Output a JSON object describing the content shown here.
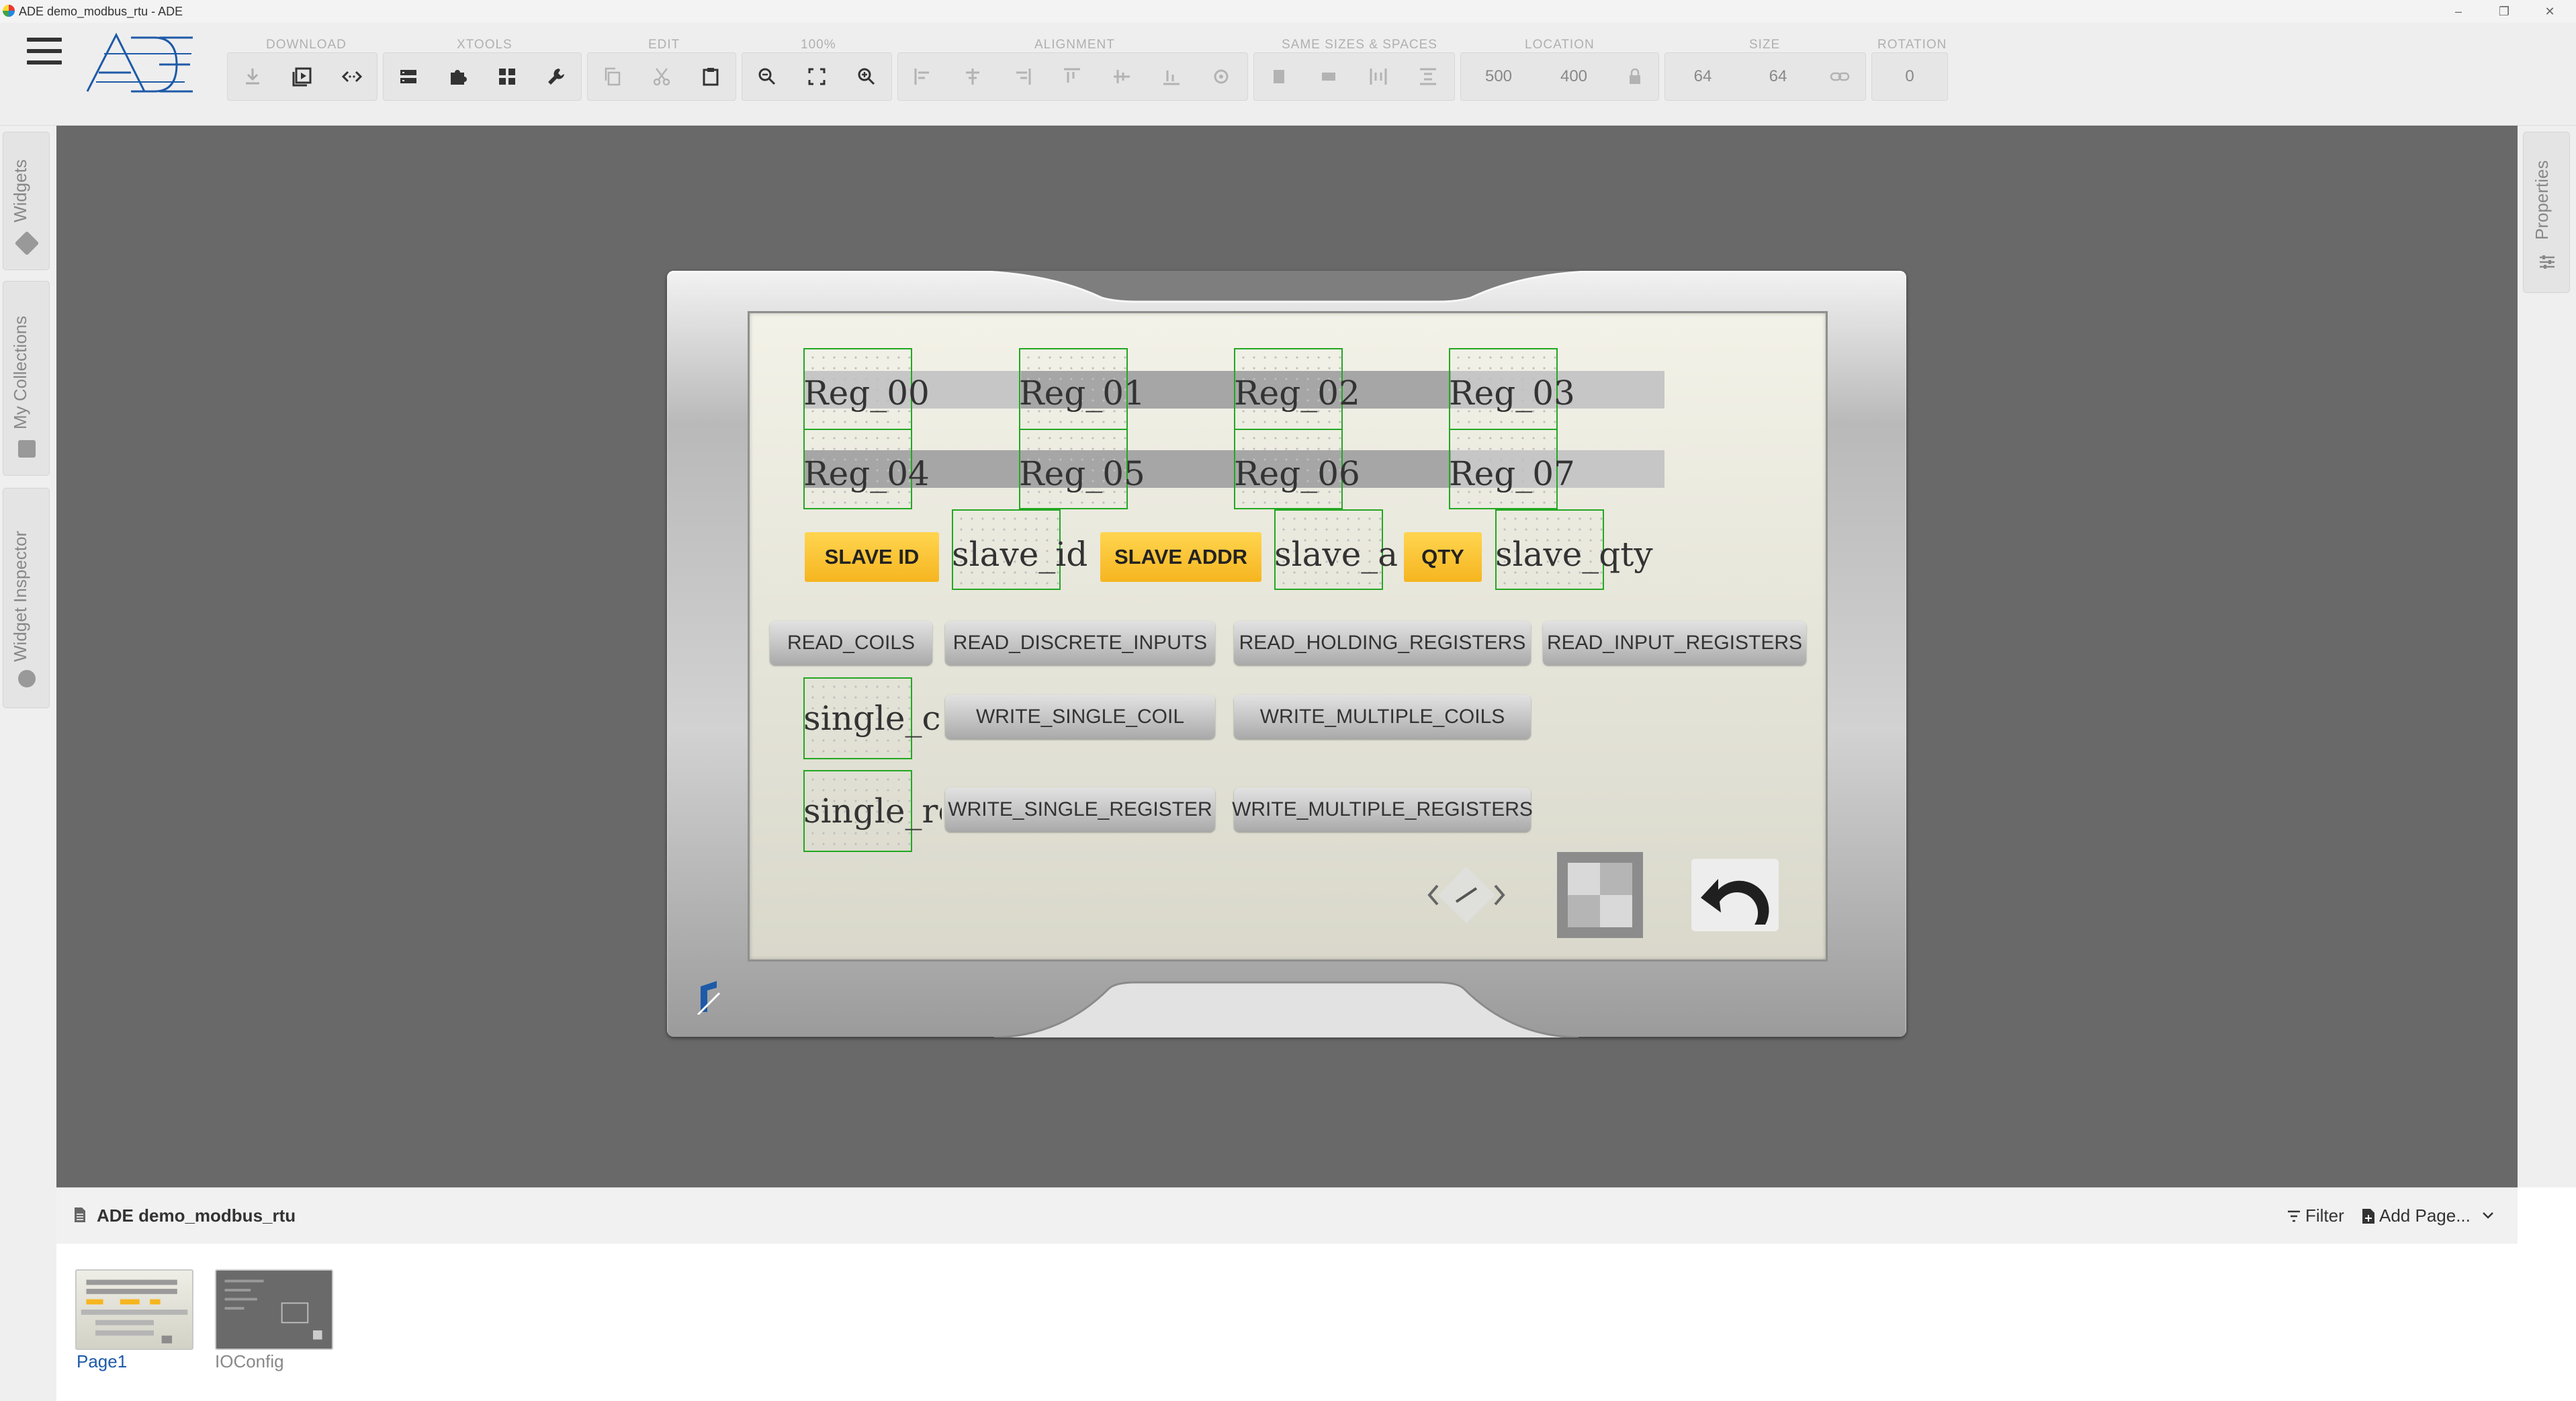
{
  "window": {
    "title": "ADE demo_modbus_rtu - ADE",
    "controls": [
      "–",
      "❐",
      "✕"
    ]
  },
  "toolbar": {
    "groups": {
      "download": "DOWNLOAD",
      "xtools": "XTOOLS",
      "edit": "EDIT",
      "zoom": "100%",
      "alignment": "ALIGNMENT",
      "same_sizes": "SAME SIZES & SPACES",
      "location": "LOCATION",
      "size": "SIZE",
      "rotation": "ROTATION"
    },
    "location": {
      "x": "500",
      "y": "400"
    },
    "size": {
      "w": "64",
      "h": "64"
    },
    "rotation": "0"
  },
  "left_sidebar": {
    "tabs": [
      "Widgets",
      "My Collections",
      "Widget Inspector"
    ]
  },
  "right_sidebar": {
    "tabs": [
      "Properties"
    ]
  },
  "screen": {
    "registers_row1": [
      "Reg_00",
      "Reg_01",
      "Reg_02",
      "Reg_03"
    ],
    "registers_row2": [
      "Reg_04",
      "Reg_05",
      "Reg_06",
      "Reg_07"
    ],
    "slave": {
      "id_label": "SLAVE ID",
      "id_var": "slave_id",
      "addr_label": "SLAVE ADDR",
      "addr_var": "slave_addr",
      "qty_label": "QTY",
      "qty_var": "slave_qty"
    },
    "read_buttons": [
      "READ_COILS",
      "READ_DISCRETE_INPUTS",
      "READ_HOLDING_REGISTERS",
      "READ_INPUT_REGISTERS"
    ],
    "single_vars": [
      "single_coil",
      "single_register"
    ],
    "write_coil_buttons": [
      "WRITE_SINGLE_COIL",
      "WRITE_MULTIPLE_COILS"
    ],
    "write_register_buttons": [
      "WRITE_SINGLE_REGISTER",
      "WRITE_MULTIPLE_REGISTERS"
    ]
  },
  "pages_panel": {
    "project_title": "ADE demo_modbus_rtu",
    "filter_label": "Filter",
    "add_page_label": "Add Page...",
    "pages": [
      {
        "name": "Page1",
        "active": true
      },
      {
        "name": "IOConfig",
        "active": false
      }
    ]
  },
  "colors": {
    "accent": "#1e5aa8",
    "canvas": "#696969",
    "yellow_button": "#f6b520",
    "selection": "#22a822"
  }
}
